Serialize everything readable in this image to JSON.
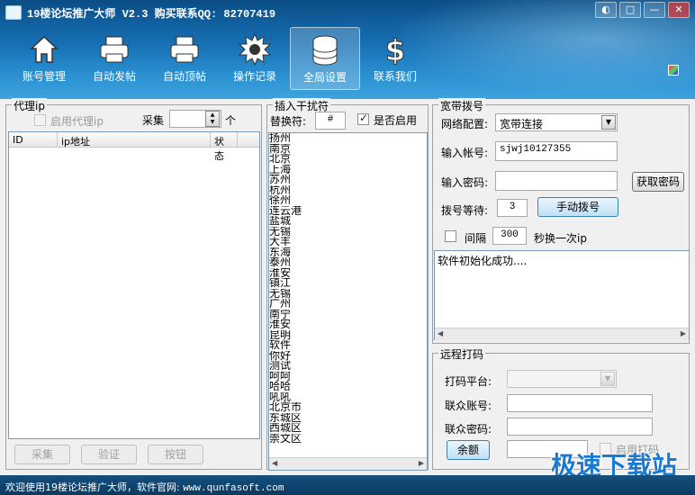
{
  "window": {
    "title": "19楼论坛推广大师 V2.3  购买联系QQ: 82707419",
    "buttons": [
      "◐",
      "□",
      "—",
      "✕"
    ]
  },
  "toolbar": [
    {
      "label": "账号管理",
      "icon": "home-icon"
    },
    {
      "label": "自动发帖",
      "icon": "printer-icon"
    },
    {
      "label": "自动顶帖",
      "icon": "printer-icon"
    },
    {
      "label": "操作记录",
      "icon": "gear-icon"
    },
    {
      "label": "全局设置",
      "icon": "database-icon",
      "active": true
    },
    {
      "label": "联系我们",
      "icon": "dollar-icon"
    }
  ],
  "proxy": {
    "group_title": "代理ip",
    "enable_label": "启用代理ip",
    "collect_label": "采集",
    "count_unit": "个",
    "count_value": "",
    "columns": [
      "ID",
      "ip地址",
      "状态"
    ],
    "buttons": [
      "采集",
      "验证",
      "按钮"
    ]
  },
  "interfere": {
    "group_title": "插入干扰符",
    "replace_label": "替换符:",
    "replace_value": "#",
    "enable_label": "是否启用",
    "enabled": true,
    "cities": [
      "扬州",
      "南京",
      "北京",
      "上海",
      "苏州",
      "杭州",
      "徐州",
      "连云港",
      "盐城",
      "无锡",
      "大丰",
      "东海",
      "泰州",
      "淮安",
      "镇江",
      "无锡",
      "广州",
      "南宁",
      "淮安",
      "昆明",
      "软件",
      "你好",
      "测试",
      "呵呵",
      "哈哈",
      "吼吼",
      "北京市",
      "东城区",
      "西城区",
      "崇文区"
    ]
  },
  "broadband": {
    "group_title": "宽带拨号",
    "config_label": "网络配置:",
    "config_value": "宽带连接",
    "account_label": "输入帐号:",
    "account_value": "sjwj10127355",
    "password_label": "输入密码:",
    "password_value": "",
    "get_password_button": "获取密码",
    "wait_label": "拨号等待:",
    "wait_value": "3",
    "manual_dial_button": "手动拨号",
    "interval_label": "间隔",
    "interval_value": "300",
    "interval_suffix": "秒换一次ip",
    "log_text": "软件初始化成功...."
  },
  "captcha": {
    "group_title": "远程打码",
    "platform_label": "打码平台:",
    "account_label": "联众账号:",
    "password_label": "联众密码:",
    "balance_button": "余额",
    "enable_label": "启用打码"
  },
  "status": {
    "text": "欢迎使用19楼论坛推广大师，软件官网: ",
    "url": "www.qunfasoft.com"
  },
  "watermark": "极速下载站"
}
